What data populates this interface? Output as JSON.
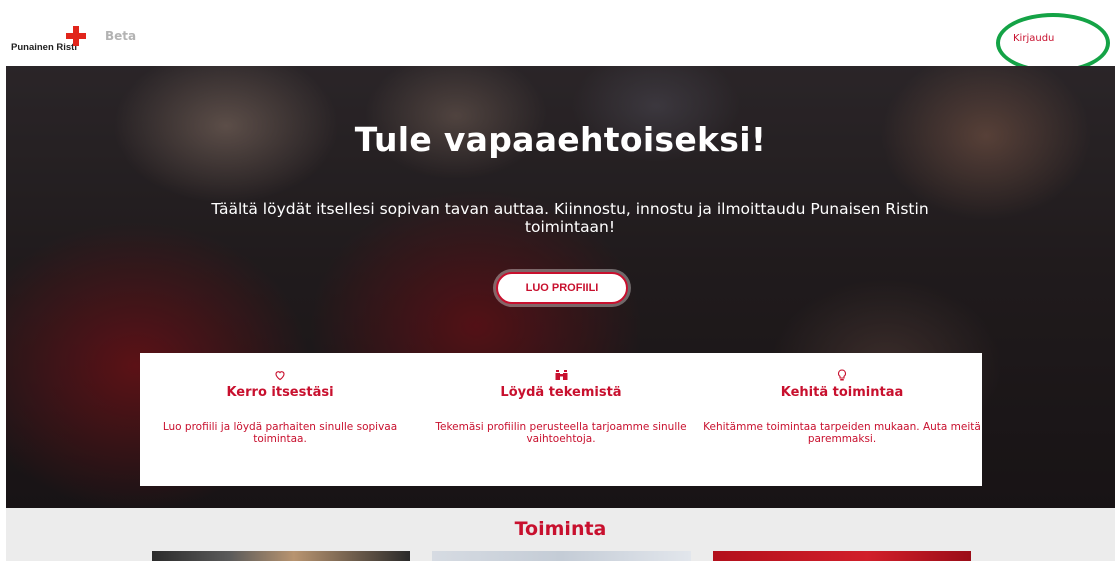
{
  "header": {
    "logo_text": "Punainen Risti",
    "beta_label": "Beta",
    "login_label": "Kirjaudu"
  },
  "hero": {
    "title": "Tule vapaaehtoiseksi!",
    "subtitle": "Täältä löydät itsellesi sopivan tavan auttaa. Kiinnostu, innostu ja ilmoittaudu Punaisen Ristin toimintaan!",
    "cta_label": "LUO PROFIILI"
  },
  "features": [
    {
      "icon": "heart-icon",
      "title": "Kerro itsestäsi",
      "text": "Luo profiili ja löydä parhaiten sinulle sopivaa toimintaa."
    },
    {
      "icon": "binoculars-icon",
      "title": "Löydä tekemistä",
      "text": "Tekemäsi profiilin perusteella tarjoamme sinulle vaihtoehtoja."
    },
    {
      "icon": "lightbulb-icon",
      "title": "Kehitä toimintaa",
      "text": "Kehitämme toimintaa tarpeiden mukaan. Auta meitä paremmaksi."
    }
  ],
  "section": {
    "title": "Toiminta"
  },
  "colors": {
    "brand_red": "#c8102e",
    "highlight_green": "#14a346"
  }
}
